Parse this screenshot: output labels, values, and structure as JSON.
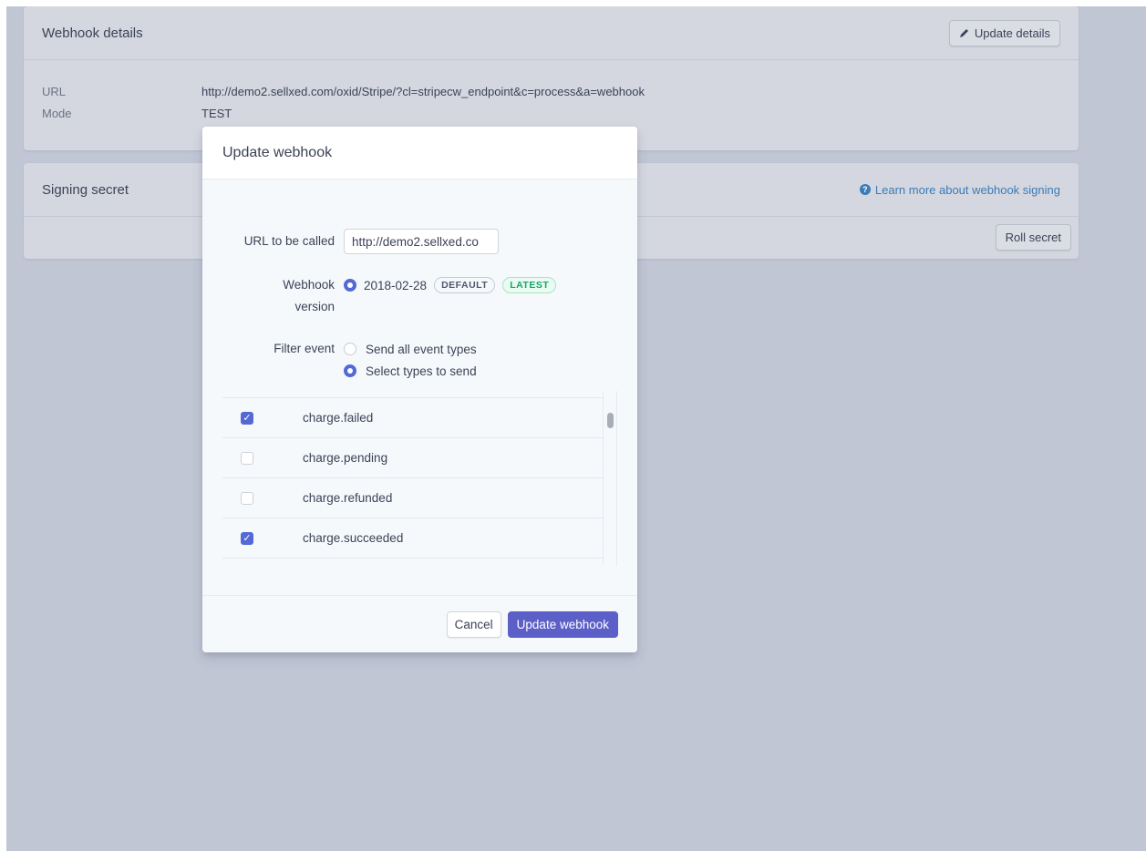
{
  "webhook_details": {
    "title": "Webhook details",
    "update_button": "Update details",
    "url_label": "URL",
    "url_value": "http://demo2.sellxed.com/oxid/Stripe/?cl=stripecw_endpoint&c=process&a=webhook",
    "mode_label": "Mode",
    "mode_value": "TEST"
  },
  "signing_secret": {
    "title": "Signing secret",
    "learn_more": "Learn more about webhook signing",
    "roll_button": "Roll secret"
  },
  "modal": {
    "title": "Update webhook",
    "url_label": "URL to be called",
    "url_value": "http://demo2.sellxed.co",
    "version_label_1": "Webhook",
    "version_label_2": "version",
    "version_value": "2018-02-28",
    "badge_default": "DEFAULT",
    "badge_latest": "LATEST",
    "filter_label": "Filter event",
    "filter_options": [
      {
        "label": "Send all event types",
        "selected": false
      },
      {
        "label": "Select types to send",
        "selected": true
      }
    ],
    "events": [
      {
        "name": "charge.failed",
        "checked": true
      },
      {
        "name": "charge.pending",
        "checked": false
      },
      {
        "name": "charge.refunded",
        "checked": false
      },
      {
        "name": "charge.succeeded",
        "checked": true
      }
    ],
    "cancel_button": "Cancel",
    "submit_button": "Update webhook"
  },
  "colors": {
    "accent": "#5469d4",
    "primary_button": "#5b5fc7",
    "latest_badge": "#17a56a",
    "link": "#3a7bb8"
  },
  "icons": {
    "update_details": "pencil-icon",
    "learn_more": "help-circle-icon",
    "checkbox_checked": "checkmark-icon"
  }
}
